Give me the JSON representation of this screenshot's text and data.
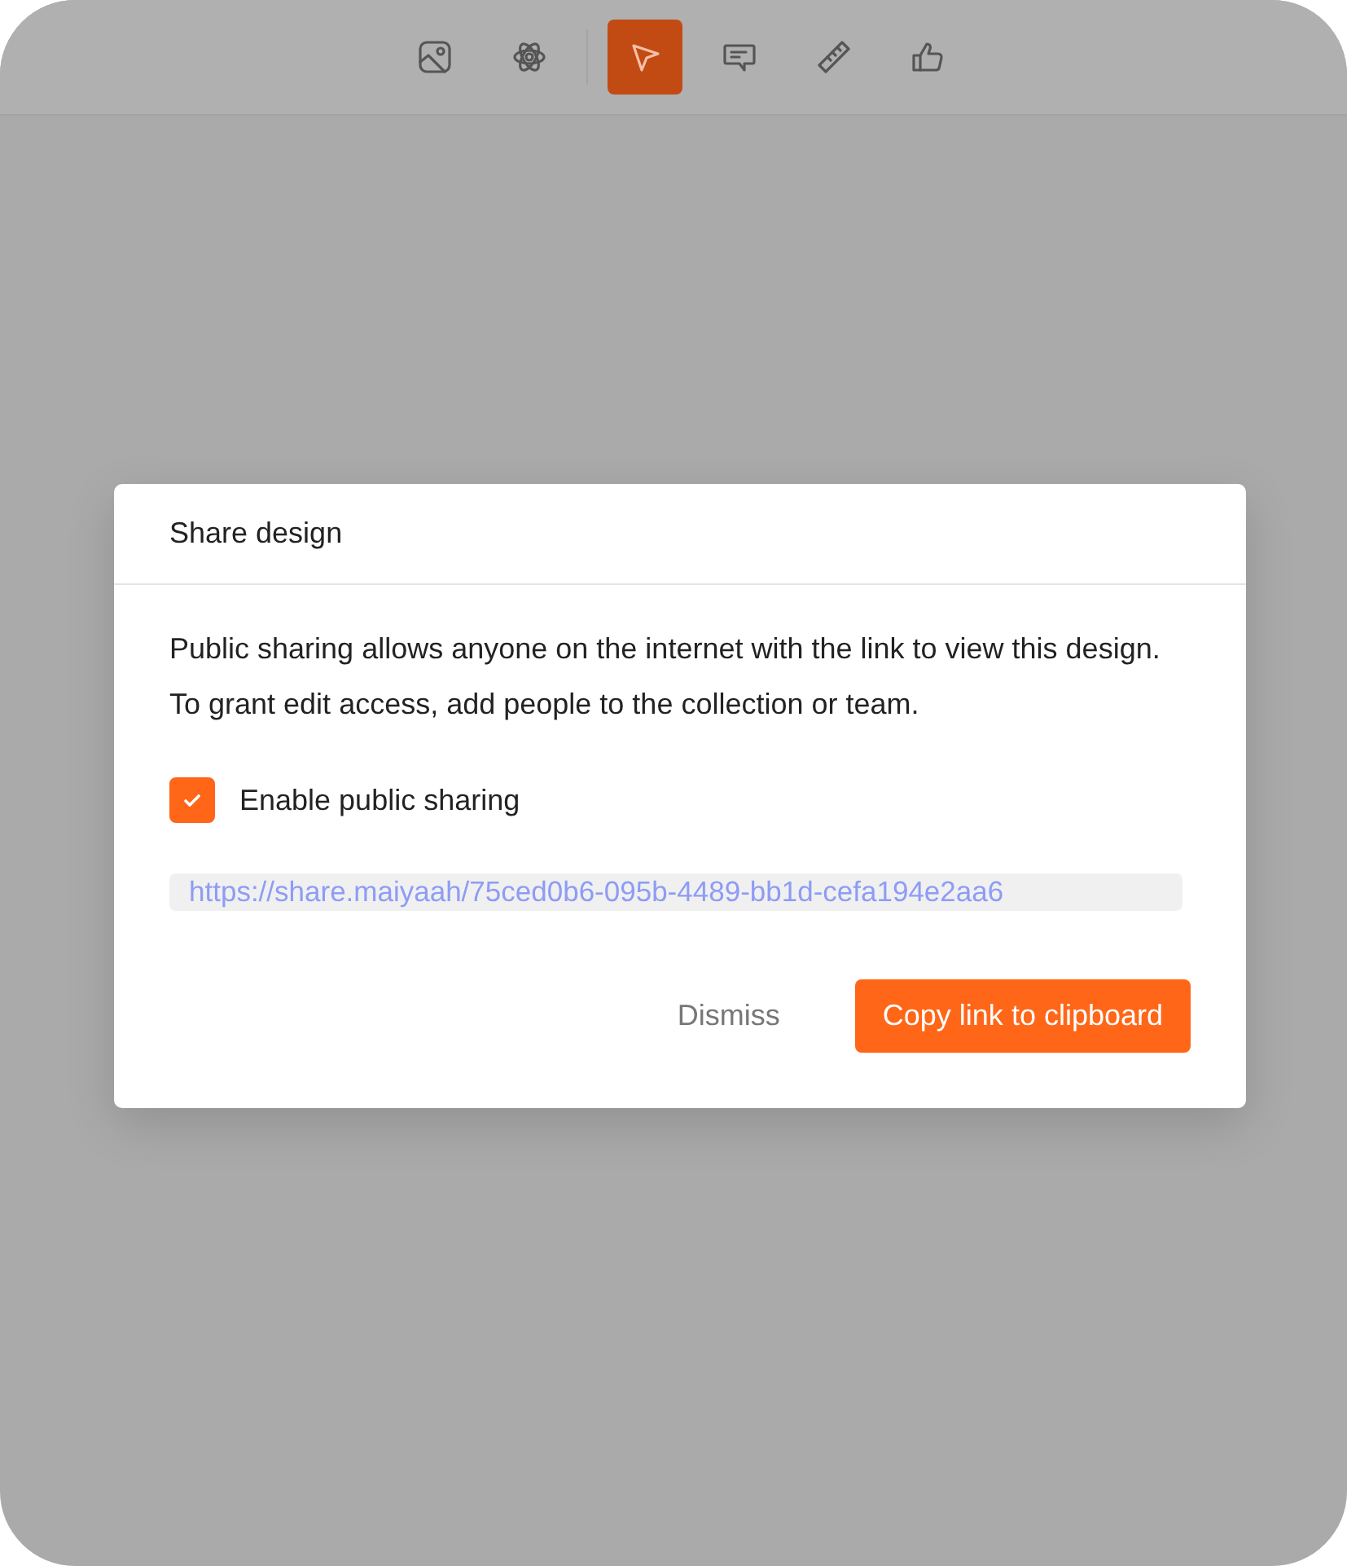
{
  "toolbar": {
    "tools": [
      {
        "kind": "image",
        "selected": false
      },
      {
        "kind": "atom",
        "selected": false
      },
      {
        "kind": "divider"
      },
      {
        "kind": "pointer",
        "selected": true
      },
      {
        "kind": "comment",
        "selected": false
      },
      {
        "kind": "ruler",
        "selected": false
      },
      {
        "kind": "thumbs-up",
        "selected": false
      }
    ]
  },
  "dialog": {
    "title": "Share design",
    "description": "Public sharing allows anyone on the internet with the link to view this design. To grant edit access, add people to the collection or team.",
    "checkbox": {
      "label": "Enable public sharing",
      "checked": true
    },
    "link": "https://share.maiyaah/75ced0b6-095b-4489-bb1d-cefa194e2aa6",
    "buttons": [
      {
        "label": "Dismiss",
        "kind": "secondary"
      },
      {
        "label": "Copy link to clipboard",
        "kind": "primary"
      }
    ]
  }
}
